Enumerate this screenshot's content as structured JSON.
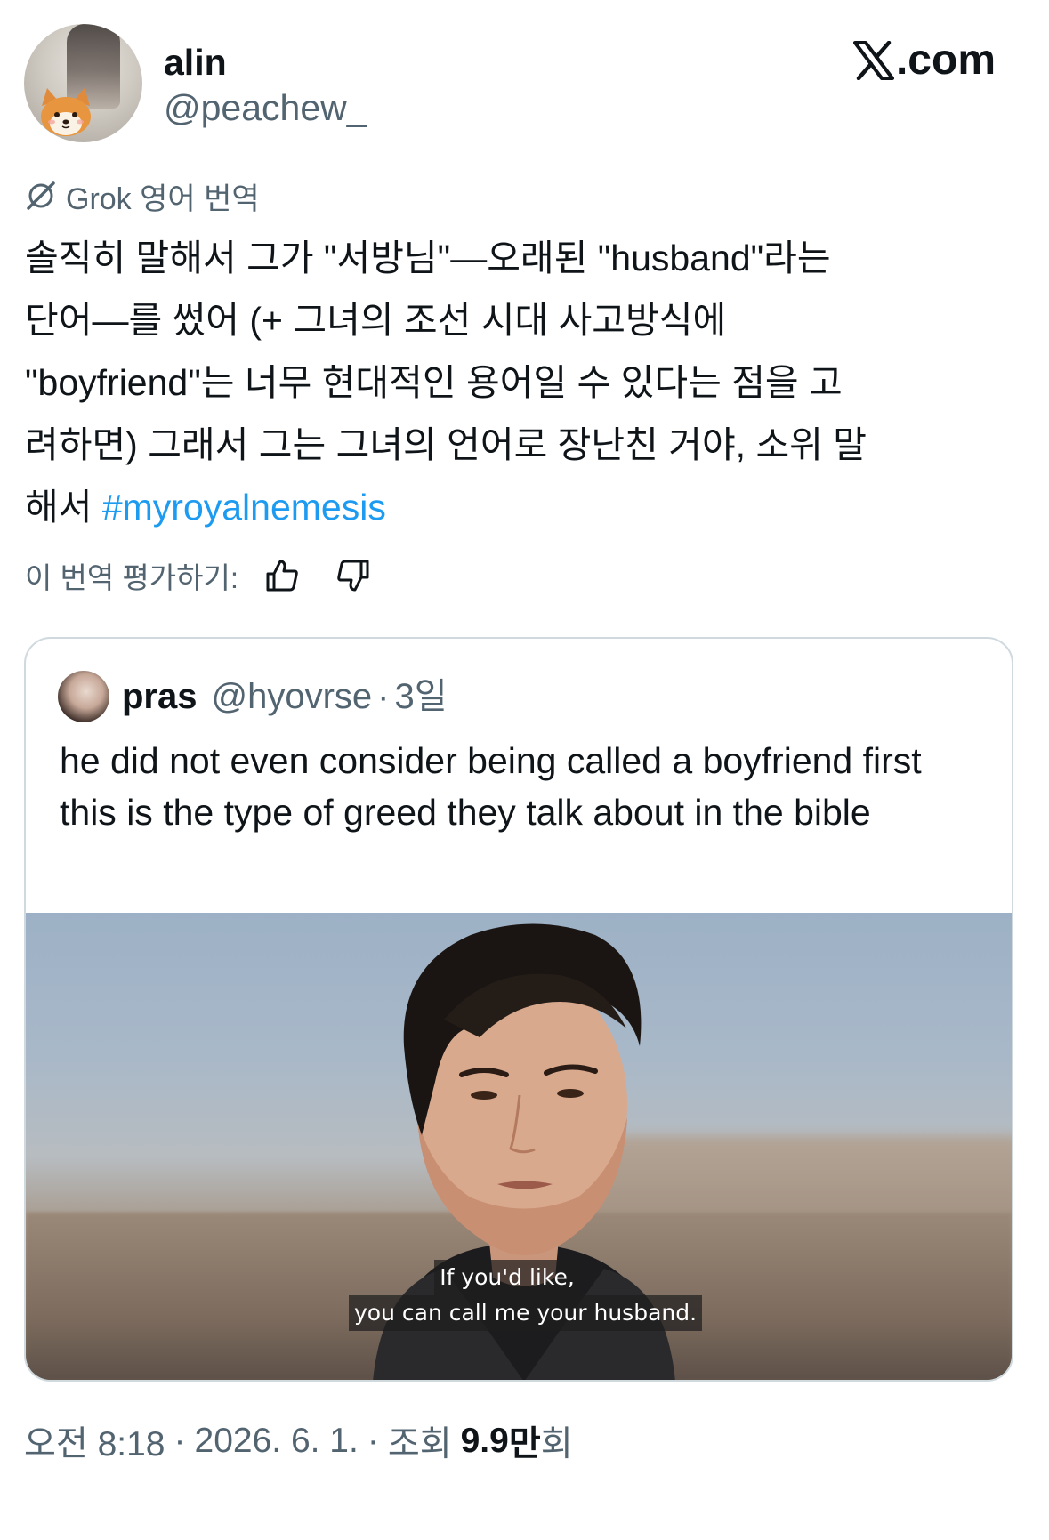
{
  "header": {
    "display_name": "alin",
    "handle": "@peachew_",
    "site_logo_text": ".com"
  },
  "translation": {
    "label": "Grok 영어 번역",
    "icon": "grok-icon"
  },
  "tweet": {
    "text": "솔직히 말해서 그가 \"서방님\"—오래된 \"husband\"라는\n단어—를 썼어 (+ 그녀의 조선 시대 사고방식에\n\"boyfriend\"는 너무 현대적인 용어일 수 있다는 점을 고\n려하면) 그래서 그는 그녀의 언어로 장난친 거야, 소위 말\n해서 ",
    "hashtag": "#myroyalnemesis",
    "hashtag_color": "#1d9bf0"
  },
  "rating": {
    "label": "이 번역 평가하기:",
    "thumbs_up_icon": "thumbs-up-icon",
    "thumbs_down_icon": "thumbs-down-icon"
  },
  "quote": {
    "display_name": "pras",
    "handle": "@hyovrse",
    "dot": "·",
    "time": "3일",
    "text": "he did not even consider being called a boyfriend first this is the type of greed they talk about in the bible",
    "subtitle_line1": "If you'd like,",
    "subtitle_line2": "you can call me your husband."
  },
  "meta": {
    "time": "오전 8:18",
    "sep1": "·",
    "date": "2026. 6. 1.",
    "sep2": "·",
    "views_label": "조회",
    "views_number": "9.9",
    "views_unit": "만",
    "views_suffix": "회"
  },
  "colors": {
    "text": "#0f1419",
    "secondary": "#536471",
    "border": "#cfd9de",
    "link": "#1d9bf0"
  }
}
